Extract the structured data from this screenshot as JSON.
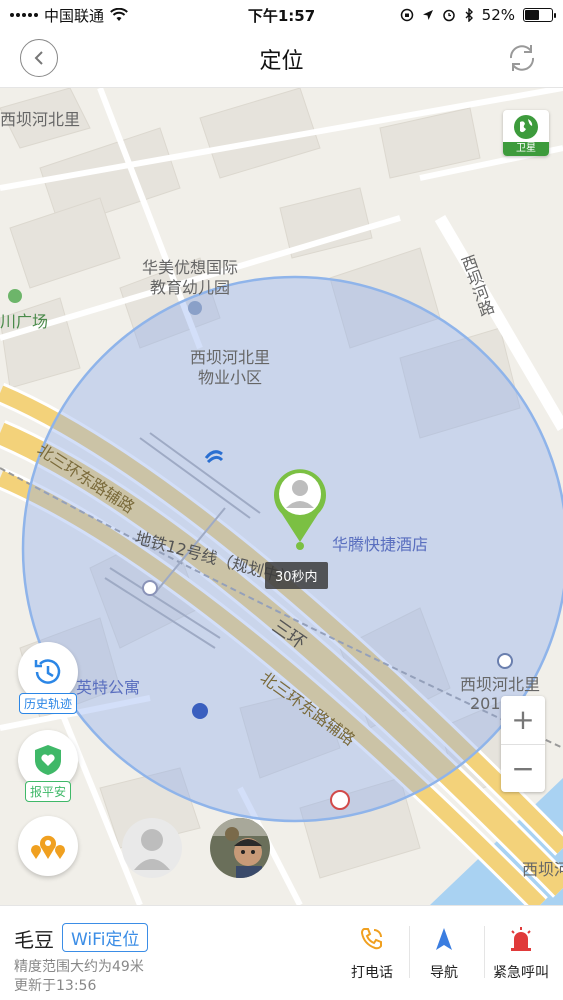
{
  "status_bar": {
    "carrier": "中国联通",
    "time": "下午1:57",
    "battery": "52%",
    "battery_level": 0.52
  },
  "nav": {
    "title": "定位",
    "back_icon": "chevron-left-icon",
    "refresh_icon": "refresh-icon"
  },
  "map": {
    "satellite_label": "卫星",
    "labels": {
      "xiba_north": "西坝河北里",
      "huamei_1": "华美优想国际",
      "huamei_2": "教育幼儿园",
      "chuan_plaza": "川广场",
      "xiba_river_road": "西坝河路",
      "xiba_property_1": "西坝河北里",
      "xiba_property_2": "物业小区",
      "ring_aux_1": "北三环东路辅路",
      "metro_line": "地铁12号线（规划中）",
      "hotel": "华腾快捷酒店",
      "ring_main": "三环",
      "yingte": "英特公寓",
      "ring_aux_2": "北三环东路辅路",
      "xiba_north_2": "西坝河北里",
      "num_201": "201",
      "xiba_right": "西坝河"
    },
    "accuracy_tag": "30秒内",
    "history_label": "历史轨迹",
    "safe_label": "报平安",
    "zoom_in": "+",
    "zoom_out": "−",
    "colors": {
      "accuracy_circle": "#8fb4ea",
      "pin": "#7bc043",
      "road_yellow": "#f3d27a"
    }
  },
  "panel": {
    "name": "毛豆",
    "location_type": "WiFi定位",
    "precision": "精度范围大约为49米",
    "updated": "更新于13:56",
    "actions": [
      {
        "label": "打电话",
        "icon": "phone-icon"
      },
      {
        "label": "导航",
        "icon": "navigation-arrow-icon"
      },
      {
        "label": "紧急呼叫",
        "icon": "alarm-siren-icon"
      }
    ]
  }
}
